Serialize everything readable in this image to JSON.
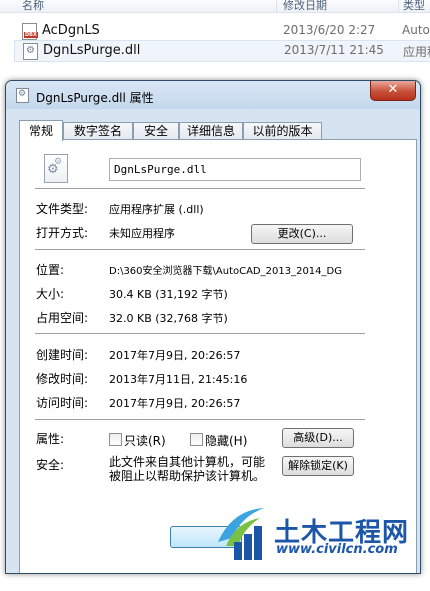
{
  "explorer": {
    "columns": {
      "name": "名称",
      "date": "修改日期",
      "type": "类型"
    },
    "files": [
      {
        "name": "AcDgnLS",
        "date": "2013/6/20 2:27",
        "type": "Auto",
        "icon": "dbx-file-icon"
      },
      {
        "name": "DgnLsPurge.dll",
        "date": "2013/7/11 21:45",
        "type": "应用程",
        "icon": "dll-file-icon"
      }
    ]
  },
  "dialog": {
    "title": "DgnLsPurge.dll 属性",
    "close_label": "✕",
    "tabs": [
      "常规",
      "数字签名",
      "安全",
      "详细信息",
      "以前的版本"
    ],
    "active_tab": "常规",
    "file_name": "DgnLsPurge.dll",
    "fields": {
      "type_label": "文件类型:",
      "type_value": "应用程序扩展 (.dll)",
      "opens_label": "打开方式:",
      "opens_value": "未知应用程序",
      "change_button": "更改(C)...",
      "location_label": "位置:",
      "location_value": "D:\\360安全浏览器下载\\AutoCAD_2013_2014_DG",
      "size_label": "大小:",
      "size_value": "30.4 KB (31,192 字节)",
      "disk_label": "占用空间:",
      "disk_value": "32.0 KB (32,768 字节)",
      "created_label": "创建时间:",
      "created_value": "2017年7月9日, 20:26:57",
      "modified_label": "修改时间:",
      "modified_value": "2013年7月11日, 21:45:16",
      "accessed_label": "访问时间:",
      "accessed_value": "2017年7月9日, 20:26:57",
      "attr_label": "属性:",
      "readonly_label": "只读(R)",
      "hidden_label": "隐藏(H)",
      "advanced_button": "高级(D)...",
      "security_label": "安全:",
      "security_text_1": "此文件来自其他计算机，可能",
      "security_text_2": "被阻止以帮助保护该计算机。",
      "unblock_button": "解除锁定(K)"
    }
  },
  "watermark": {
    "title": "土木工程网",
    "url": "www.civilcn.com"
  },
  "colors": {
    "accent": "#1b56a8",
    "dialog_frame": "#d6e4f2",
    "close": "#c7503a"
  }
}
